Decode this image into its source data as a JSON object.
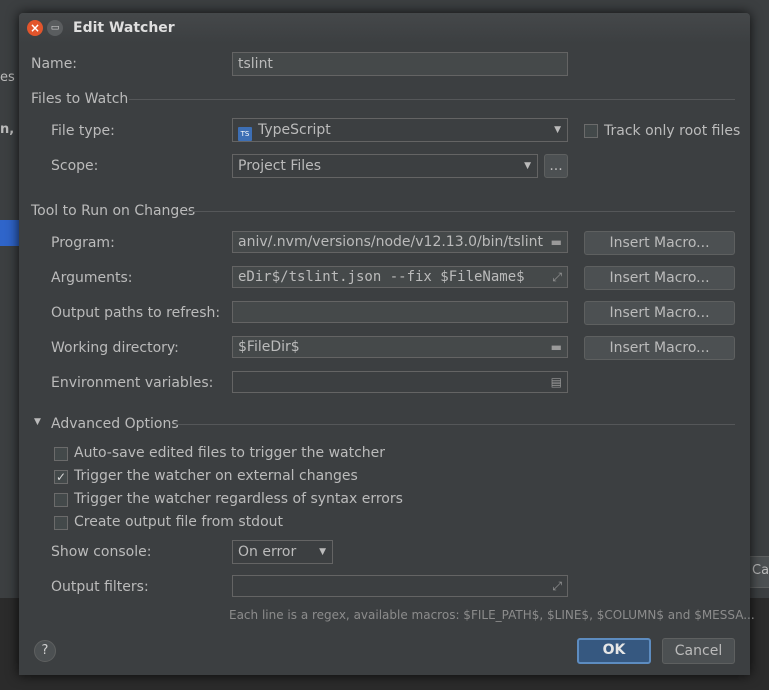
{
  "background": {
    "left_labels": [
      "es",
      "n, l"
    ],
    "right_button_label": "Ca"
  },
  "dialog": {
    "title": "Edit Watcher",
    "name_label": "Name:",
    "name_value": "tslint",
    "files_section": "Files to Watch",
    "file_type_label": "File type:",
    "file_type_icon_text": "TS",
    "file_type_value": "TypeScript",
    "track_root_label": "Track only root files",
    "scope_label": "Scope:",
    "scope_value": "Project Files",
    "scope_more": "...",
    "tool_section": "Tool to Run on Changes",
    "program_label": "Program:",
    "program_value": "aniv/.nvm/versions/node/v12.13.0/bin/tslint",
    "arguments_label": "Arguments:",
    "arguments_value": "eDir$/tslint.json --fix $FileName$",
    "output_paths_label": "Output paths to refresh:",
    "output_paths_value": "",
    "working_dir_label": "Working directory:",
    "working_dir_value": "$FileDir$",
    "env_label": "Environment variables:",
    "env_value": "",
    "insert_macro": "Insert Macro...",
    "advanced_section": "Advanced Options",
    "options": [
      {
        "label": "Auto-save edited files to trigger the watcher",
        "checked": false
      },
      {
        "label": "Trigger the watcher on external changes",
        "checked": true
      },
      {
        "label": "Trigger the watcher regardless of syntax errors",
        "checked": false
      },
      {
        "label": "Create output file from stdout",
        "checked": false
      }
    ],
    "check_mark": "✓",
    "show_console_label": "Show console:",
    "show_console_value": "On error",
    "output_filters_label": "Output filters:",
    "output_filters_value": "",
    "hint": "Each line is a regex, available macros: $FILE_PATH$, $LINE$, $COLUMN$ and $MESSA...",
    "help": "?",
    "ok": "OK",
    "cancel": "Cancel"
  },
  "colors": {
    "accent": "#365880",
    "selection": "#2f65ca",
    "close_button": "#e2552c"
  }
}
